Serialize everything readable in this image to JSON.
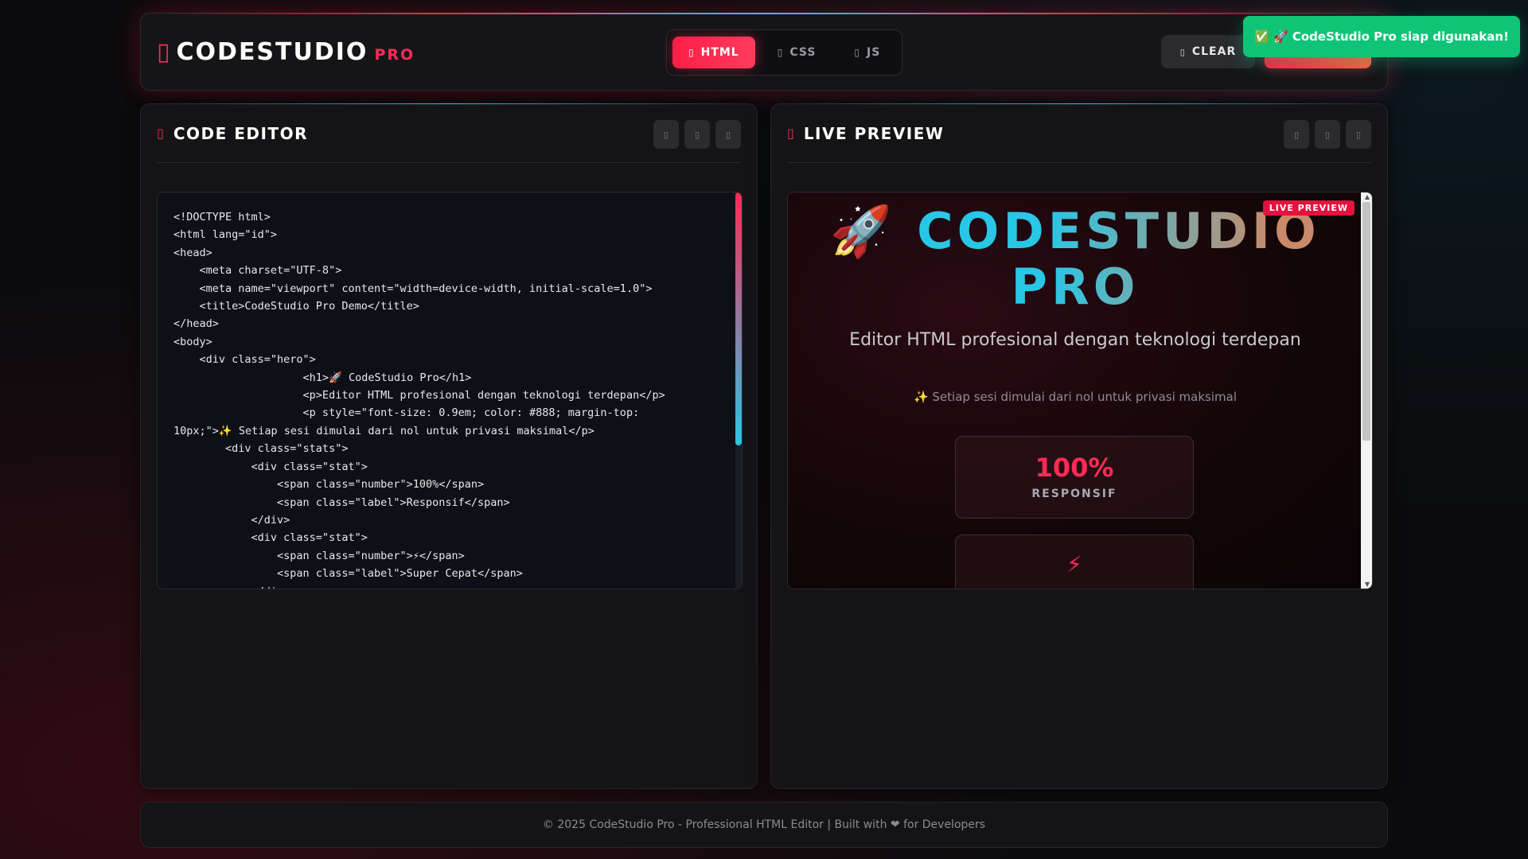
{
  "header": {
    "logo_text": "CODESTUDIO",
    "logo_pro": "PRO",
    "tabs": [
      {
        "label": "HTML",
        "active": true
      },
      {
        "label": "CSS",
        "active": false
      },
      {
        "label": "JS",
        "active": false
      }
    ],
    "clear_label": "CLEAR",
    "run_label": ""
  },
  "editor": {
    "title": "CODE EDITOR",
    "code": "<!DOCTYPE html>\n<html lang=\"id\">\n<head>\n    <meta charset=\"UTF-8\">\n    <meta name=\"viewport\" content=\"width=device-width, initial-scale=1.0\">\n    <title>CodeStudio Pro Demo</title>\n</head>\n<body>\n    <div class=\"hero\">\n                    <h1>🚀 CodeStudio Pro</h1>\n                    <p>Editor HTML profesional dengan teknologi terdepan</p>\n                    <p style=\"font-size: 0.9em; color: #888; margin-top:\n10px;\">✨ Setiap sesi dimulai dari nol untuk privasi maksimal</p>\n        <div class=\"stats\">\n            <div class=\"stat\">\n                <span class=\"number\">100%</span>\n                <span class=\"label\">Responsif</span>\n            </div>\n            <div class=\"stat\">\n                <span class=\"number\">⚡</span>\n                <span class=\"label\">Super Cepat</span>\n            </div>"
  },
  "preview": {
    "title": "LIVE PREVIEW",
    "badge": "LIVE PREVIEW",
    "rocket": "🚀",
    "h1": "CODESTUDIO PRO",
    "subtitle": "Editor HTML profesional dengan teknologi terdepan",
    "note": "✨ Setiap sesi dimulai dari nol untuk privasi maksimal",
    "stats": [
      {
        "number": "100%",
        "label": "RESPONSIF"
      },
      {
        "number": "⚡",
        "label": ""
      }
    ]
  },
  "footer": {
    "text": "© 2025 CodeStudio Pro - Professional HTML Editor | Built with ❤ for Developers"
  },
  "toast": {
    "text": "✅ 🚀 CodeStudio Pro siap digunakan!"
  },
  "colors": {
    "accent": "#ff2a55",
    "secondary": "#29c7e6",
    "success": "#10c477",
    "background": "#0b0b0d"
  },
  "icons": {
    "logo": "code-icon",
    "tab_html": "html5-icon",
    "tab_css": "css3-icon",
    "tab_js": "js-icon",
    "clear": "trash-icon",
    "editor_panel": "code-icon",
    "preview_panel": "eye-icon"
  }
}
